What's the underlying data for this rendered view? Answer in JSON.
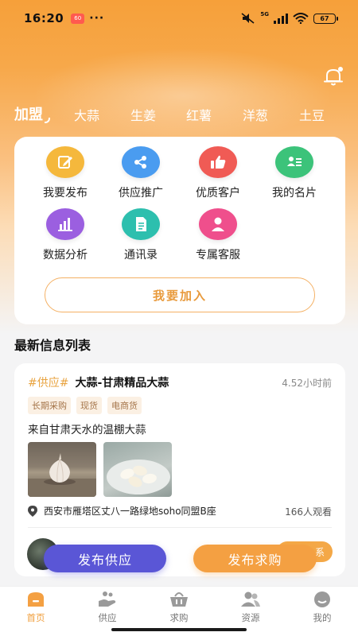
{
  "status_bar": {
    "time": "16:20",
    "app_badge": "60",
    "dots": "···",
    "network": "5G",
    "battery": "67"
  },
  "header": {
    "bell_icon": "bell-icon",
    "categories": [
      {
        "label": "加盟",
        "active": true
      },
      {
        "label": "大蒜",
        "active": false
      },
      {
        "label": "生姜",
        "active": false
      },
      {
        "label": "红薯",
        "active": false
      },
      {
        "label": "洋葱",
        "active": false
      },
      {
        "label": "土豆",
        "active": false
      }
    ]
  },
  "functions": {
    "items": [
      {
        "label": "我要发布",
        "icon": "edit-icon",
        "color": "#f5b83c"
      },
      {
        "label": "供应推广",
        "icon": "share-icon",
        "color": "#4a9cf0"
      },
      {
        "label": "优质客户",
        "icon": "thumbs-up-icon",
        "color": "#f05b55"
      },
      {
        "label": "我的名片",
        "icon": "card-icon",
        "color": "#3cc37a"
      },
      {
        "label": "数据分析",
        "icon": "bar-chart-icon",
        "color": "#9b5fe0"
      },
      {
        "label": "通讯录",
        "icon": "document-icon",
        "color": "#2dbfae"
      },
      {
        "label": "专属客服",
        "icon": "user-icon",
        "color": "#ef4f8c"
      }
    ],
    "join_label": "我要加入"
  },
  "list": {
    "section_title": "最新信息列表",
    "item": {
      "tag": "#供应#",
      "title": "大蒜-甘肃精品大蒜",
      "time": "4.52小时前",
      "chips": [
        "长期采购",
        "现货",
        "电商货"
      ],
      "description": "来自甘肃天水的温棚大蒜",
      "location": "西安市雁塔区丈八一路绿地soho同盟B座",
      "views": "166人观看",
      "contact_label": "系"
    }
  },
  "actions": {
    "publish_supply": "发布供应",
    "publish_demand": "发布求购"
  },
  "bottom_nav": {
    "items": [
      {
        "label": "首页",
        "icon": "home-icon",
        "active": true
      },
      {
        "label": "供应",
        "icon": "supply-hand-icon",
        "active": false
      },
      {
        "label": "求购",
        "icon": "basket-icon",
        "active": false
      },
      {
        "label": "资源",
        "icon": "people-icon",
        "active": false
      },
      {
        "label": "我的",
        "icon": "profile-icon",
        "active": false
      }
    ]
  },
  "colors": {
    "accent": "#f4a042",
    "secondary": "#5a56d6"
  }
}
